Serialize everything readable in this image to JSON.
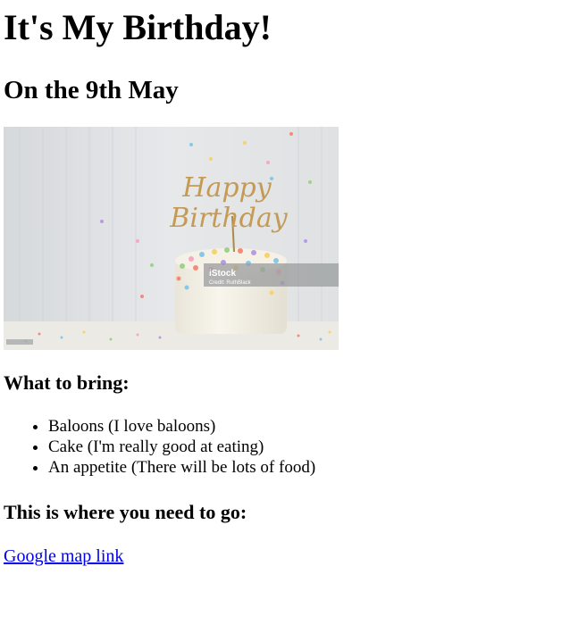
{
  "heading": {
    "title": "It's My Birthday!",
    "date": "On the 9th May"
  },
  "image": {
    "cake_topper_line1": "Happy",
    "cake_topper_line2": "Birthday",
    "watermark_brand": "iStock",
    "watermark_credit": "Credit: RuthBlack"
  },
  "bring": {
    "title": "What to bring:",
    "items": [
      "Baloons (I love baloons)",
      "Cake (I'm really good at eating)",
      "An appetite (There will be lots of food)"
    ]
  },
  "location": {
    "title": "This is where you need to go:",
    "link_label": "Google map link"
  },
  "colors": {
    "link": "#0000ee",
    "text": "#000000",
    "background": "#ffffff"
  }
}
